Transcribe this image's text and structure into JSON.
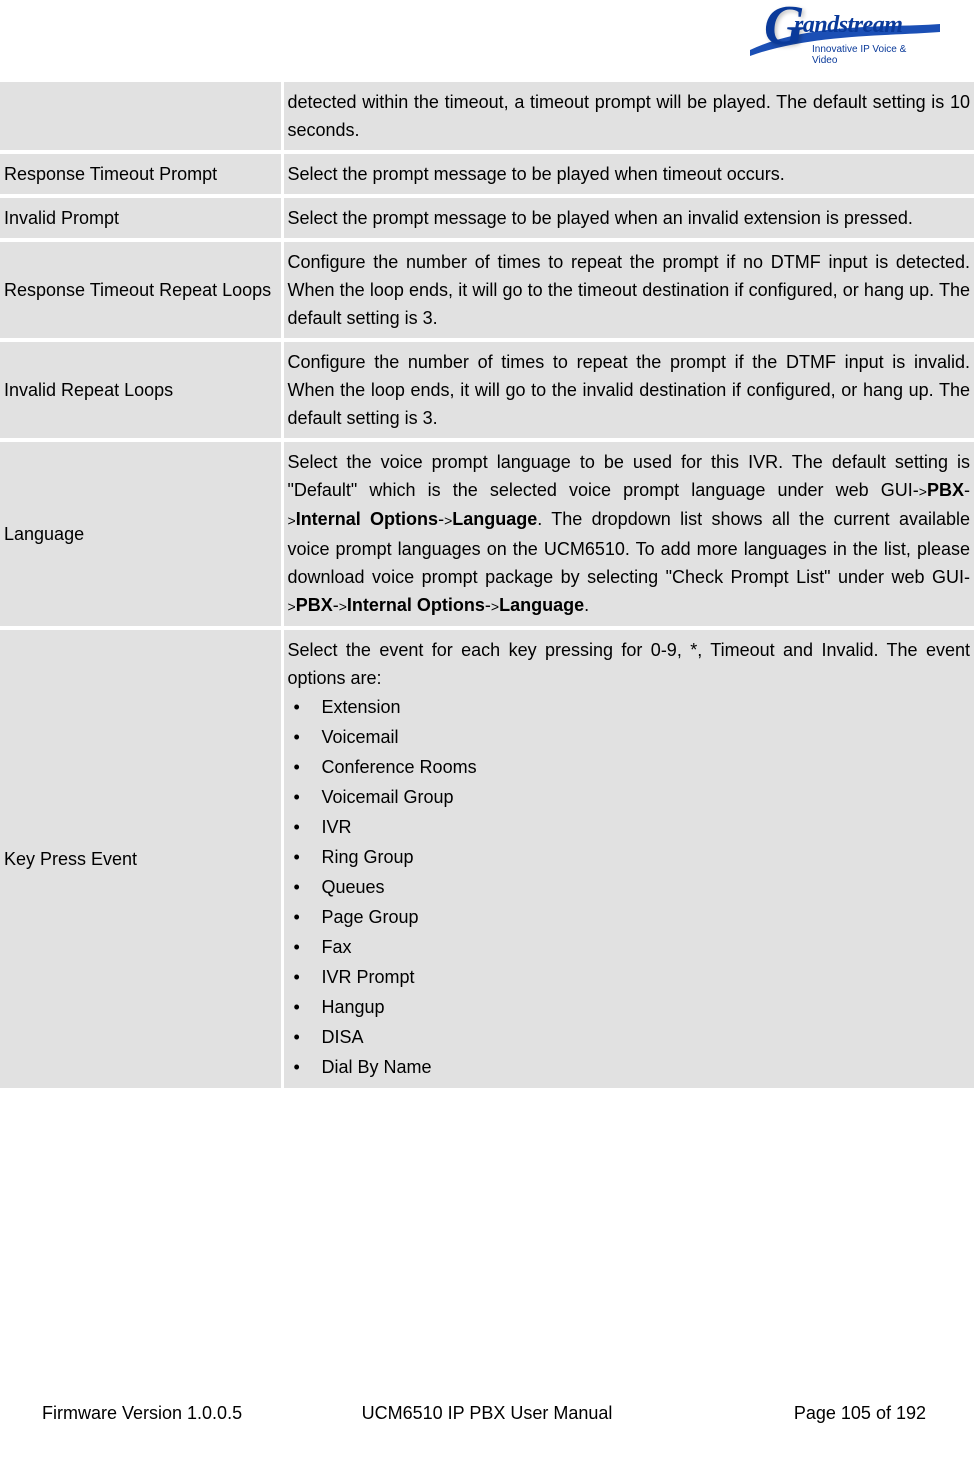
{
  "logo": {
    "brand": "randstream",
    "tagline": "Innovative IP Voice & Video"
  },
  "rows": {
    "r0": {
      "name": "",
      "desc_plain": "detected within the timeout, a timeout prompt will be played. The default setting is 10 seconds."
    },
    "r1": {
      "name": "Response Timeout Prompt",
      "desc_plain": "Select the prompt message to be played when timeout occurs."
    },
    "r2": {
      "name": "Invalid Prompt",
      "desc_plain": "Select the prompt message to be played when an invalid extension is pressed."
    },
    "r3": {
      "name": "Response Timeout Repeat Loops",
      "desc_plain": "Configure the number of times to repeat the prompt if no DTMF input is detected. When the loop ends, it will go to the timeout destination if configured, or hang up. The default setting is 3."
    },
    "r4": {
      "name": "Invalid Repeat Loops",
      "desc_plain": "Configure the number of times to repeat the prompt if the DTMF input is invalid. When the loop ends, it will go to the invalid destination if configured, or hang up. The default setting is 3."
    },
    "r5": {
      "name": "Language",
      "desc_parts": {
        "p0": "Select the voice prompt language to be used for this IVR. The default setting is \"Default\" which is the selected voice prompt language under web GUI-",
        "pbx": "PBX",
        "gt": ">",
        "internal_options": "Internal Options",
        "language": "Language",
        "p1": ". The dropdown list shows all the current available voice prompt languages on the UCM6510. To add more languages in the list, please download voice prompt package by selecting \"Check Prompt List\" under web GUI-"
      }
    },
    "r6": {
      "name": "Key Press Event",
      "intro": "Select the event for each key pressing for 0-9, *, Timeout and Invalid. The event options are:",
      "options": [
        "Extension",
        "Voicemail",
        "Conference Rooms",
        "Voicemail Group",
        "IVR",
        "Ring Group",
        "Queues",
        "Page Group",
        "Fax",
        "IVR Prompt",
        "Hangup",
        "DISA",
        "Dial By Name"
      ]
    }
  },
  "footer": {
    "left": "Firmware Version 1.0.0.5",
    "center": "UCM6510 IP PBX User Manual",
    "right": "Page 105 of 192"
  }
}
